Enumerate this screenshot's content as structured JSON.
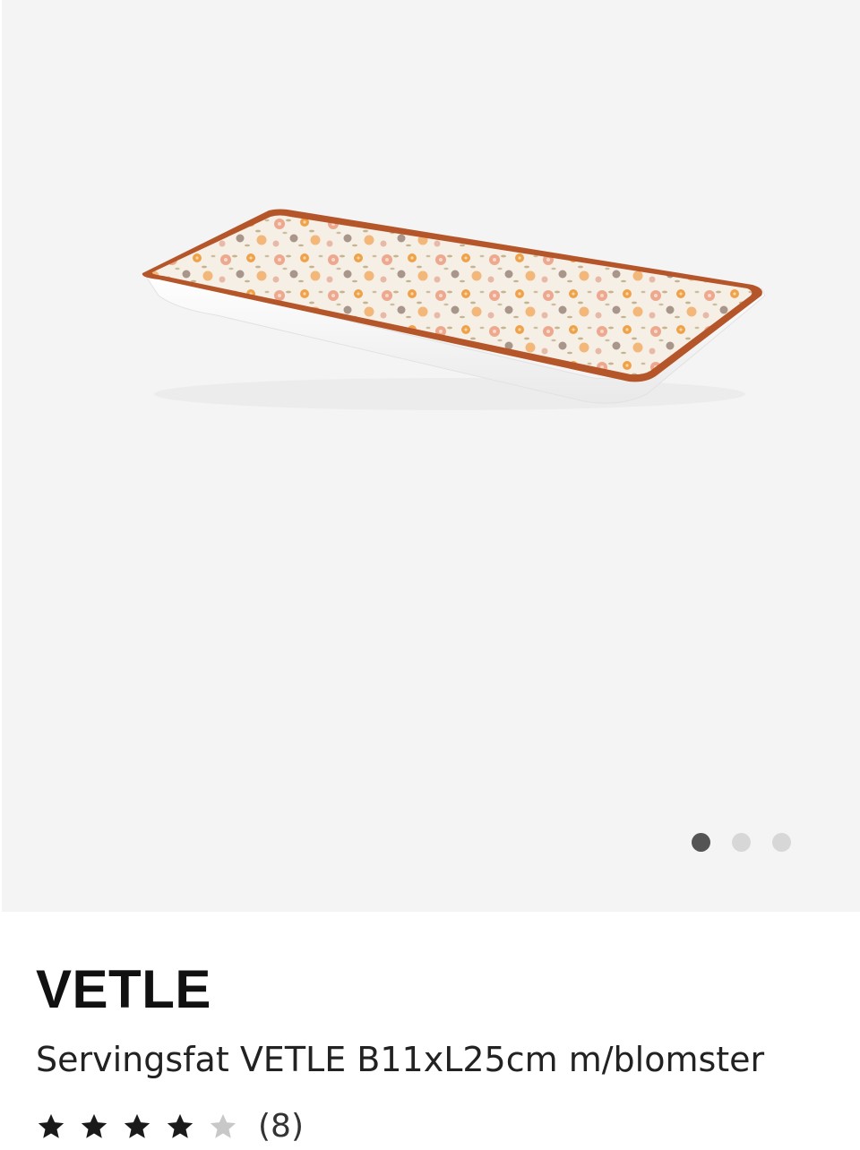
{
  "gallery": {
    "image_alt": "Servingsfat VETLE B11xL25cm m/blomster",
    "slide_count": 3,
    "active_slide": 1
  },
  "product": {
    "brand": "VETLE",
    "name": "Servingsfat VETLE B11xL25cm m/blomster"
  },
  "rating": {
    "stars": 4,
    "max_stars": 5,
    "count_text": "(8)"
  },
  "colors": {
    "gallery_bg": "#f4f4f4",
    "dot_active": "#545454",
    "dot_inactive": "#d7d7d7",
    "plate_rim": "#b5562a"
  }
}
